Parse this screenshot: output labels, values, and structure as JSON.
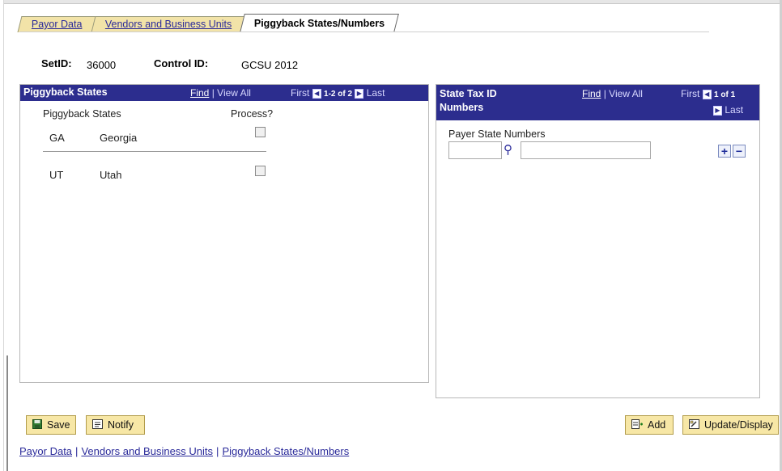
{
  "tabs": [
    {
      "label": "Payor Data"
    },
    {
      "label": "Vendors and Business Units"
    },
    {
      "label": "Piggyback States/Numbers"
    }
  ],
  "header": {
    "setid_label": "SetID:",
    "setid_value": "36000",
    "control_label": "Control ID:",
    "control_value": "GCSU 2012"
  },
  "left_panel": {
    "title": "Piggyback States",
    "find": "Find",
    "sep": "|",
    "view_all": "View All",
    "first": "First",
    "range": "1-2 of 2",
    "last": "Last",
    "col_states": "Piggyback States",
    "col_process": "Process?",
    "rows": [
      {
        "code": "GA",
        "name": "Georgia",
        "process": false
      },
      {
        "code": "UT",
        "name": "Utah",
        "process": false
      }
    ]
  },
  "right_panel": {
    "title_line1": "State Tax ID",
    "title_line2": "Numbers",
    "find": "Find",
    "sep": "|",
    "view_all": "View All",
    "first": "First",
    "range": "1 of 1",
    "last": "Last",
    "field_label": "Payer State Numbers",
    "state_value": "",
    "number_value": "",
    "add_row": "+",
    "delete_row": "−"
  },
  "buttons": {
    "save": "Save",
    "notify": "Notify",
    "add": "Add",
    "update_display": "Update/Display"
  },
  "footer_links": [
    "Payor Data",
    "Vendors and Business Units",
    "Piggyback States/Numbers"
  ],
  "colors": {
    "tab_bg": "#f2e3a8",
    "grid_header_bg": "#2c2d8e",
    "button_bg": "#f7e7a6",
    "link": "#2a2a9a"
  }
}
